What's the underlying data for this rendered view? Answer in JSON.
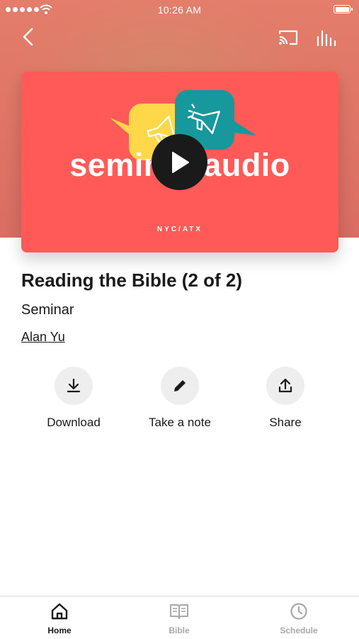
{
  "status_bar": {
    "time": "10:26 AM",
    "battery_level": 1.0
  },
  "nav": {
    "back_icon": "chevron-left-icon",
    "cast_icon": "cast-icon",
    "equalizer_icon": "equalizer-icon"
  },
  "artwork": {
    "title": "seminar audio",
    "subtitle": "NYC/ATX",
    "background_color": "#ff5a57",
    "bubble_yellow": "#ffd84a",
    "bubble_teal": "#17989c",
    "play_icon": "play-icon"
  },
  "episode": {
    "title": "Reading the Bible (2 of 2)",
    "category": "Seminar",
    "speaker": "Alan Yu"
  },
  "actions": [
    {
      "label": "Download",
      "icon": "download-icon"
    },
    {
      "label": "Take a note",
      "icon": "pencil-icon"
    },
    {
      "label": "Share",
      "icon": "share-icon"
    }
  ],
  "tabs": [
    {
      "label": "Home",
      "icon": "home-icon",
      "active": true
    },
    {
      "label": "Bible",
      "icon": "book-icon",
      "active": false
    },
    {
      "label": "Schedule",
      "icon": "clock-icon",
      "active": false
    }
  ]
}
